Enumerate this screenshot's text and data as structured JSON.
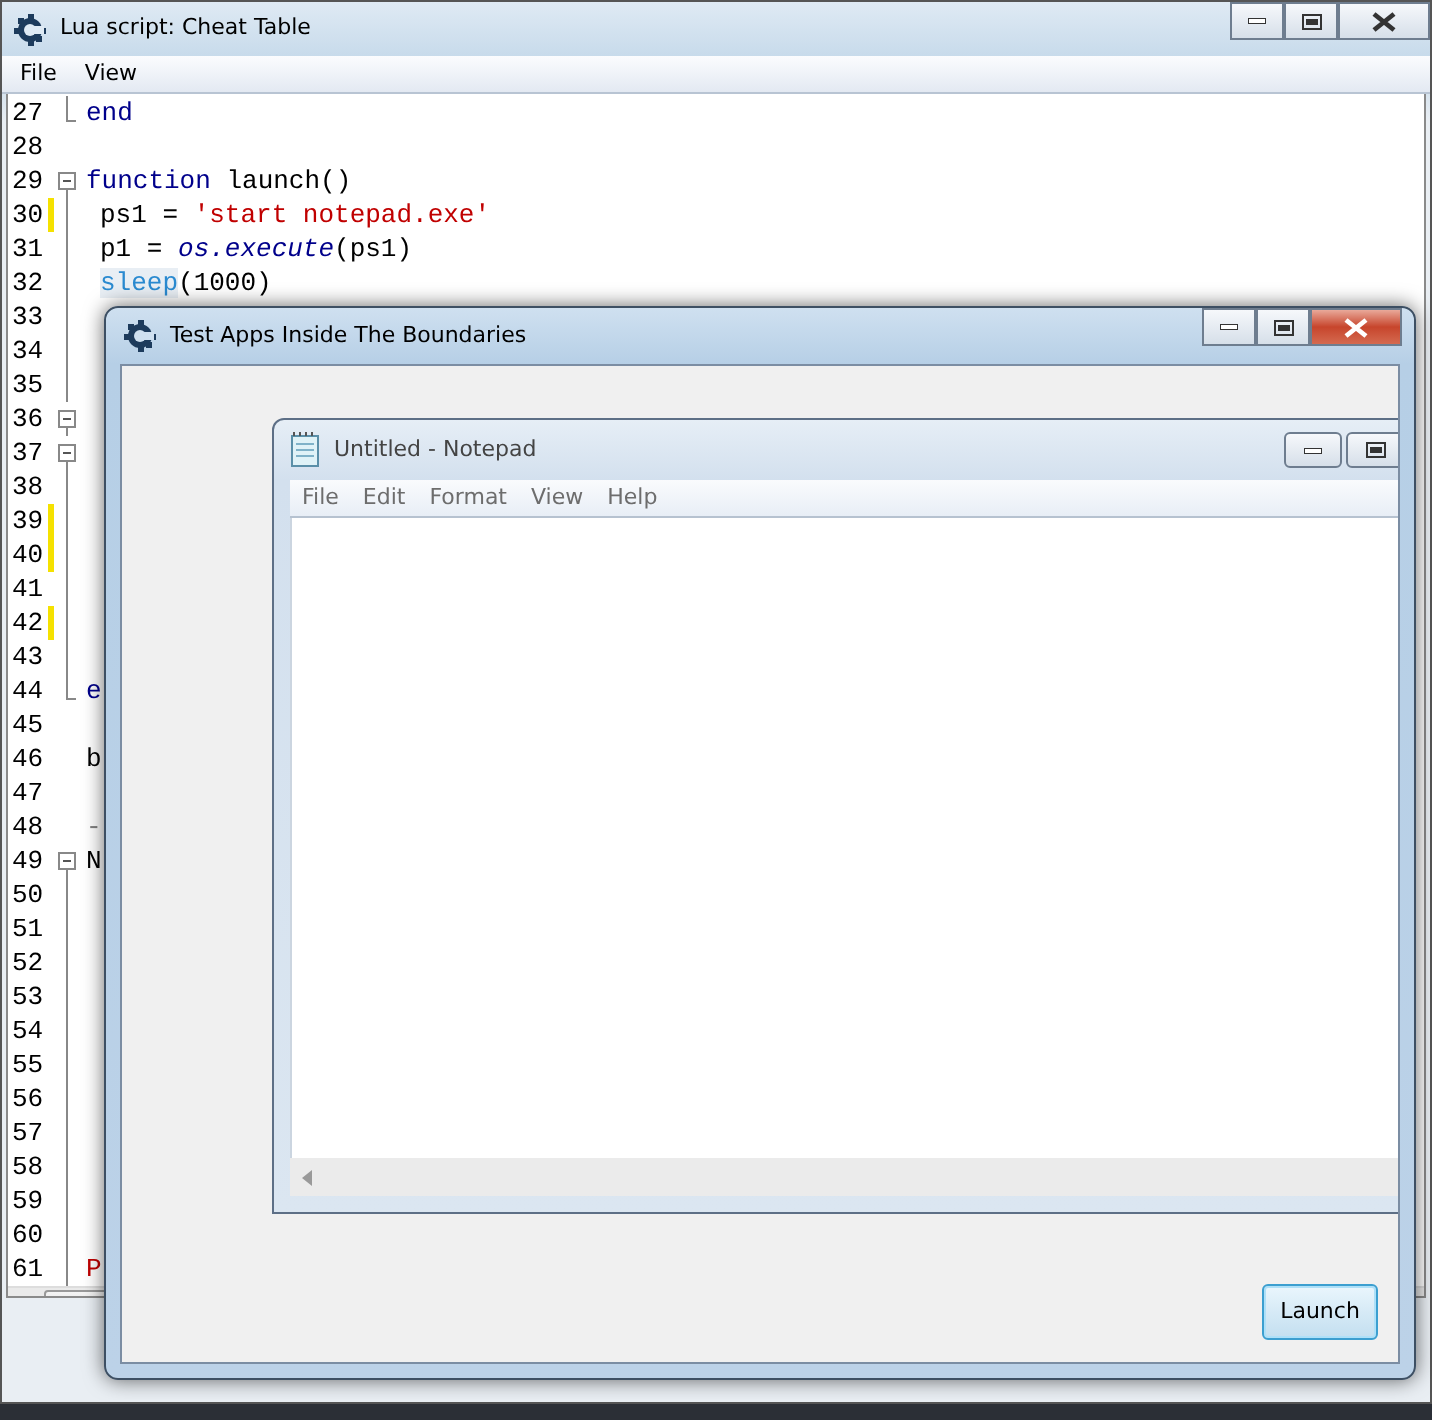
{
  "editor_window": {
    "title": "Lua script: Cheat Table",
    "menu": [
      {
        "label": "File"
      },
      {
        "label": "View"
      }
    ],
    "lines": [
      {
        "number": "27",
        "changed": false,
        "kind": "end",
        "indented": false,
        "tokens": [
          {
            "kind": "keyword",
            "text": "end"
          }
        ]
      },
      {
        "number": "28",
        "changed": false,
        "kind": "plain"
      },
      {
        "number": "29",
        "changed": false,
        "kind": "start",
        "indented": false,
        "tokens": [
          {
            "kind": "keyword",
            "text": "function"
          },
          {
            "kind": "plain",
            "text": " launch()"
          }
        ]
      },
      {
        "number": "30",
        "changed": true,
        "kind": "body",
        "indented": true,
        "tokens": [
          {
            "kind": "plain",
            "text": "ps1 = "
          },
          {
            "kind": "string",
            "text": "'start notepad.exe'"
          }
        ]
      },
      {
        "number": "31",
        "changed": false,
        "kind": "body",
        "indented": true,
        "tokens": [
          {
            "kind": "plain",
            "text": "p1 = "
          },
          {
            "kind": "library",
            "text": "os.execute"
          },
          {
            "kind": "plain",
            "text": "(ps1)"
          }
        ]
      },
      {
        "number": "32",
        "changed": false,
        "kind": "body",
        "indented": true,
        "tokens": [
          {
            "kind": "builtin",
            "text": "sleep"
          },
          {
            "kind": "plain",
            "text": "(1000)"
          }
        ]
      },
      {
        "number": "33",
        "changed": false,
        "kind": "body"
      },
      {
        "number": "34",
        "changed": false,
        "kind": "body"
      },
      {
        "number": "35",
        "changed": false,
        "kind": "body"
      },
      {
        "number": "36",
        "changed": false,
        "kind": "start"
      },
      {
        "number": "37",
        "changed": false,
        "kind": "start"
      },
      {
        "number": "38",
        "changed": false,
        "kind": "body"
      },
      {
        "number": "39",
        "changed": true,
        "kind": "body"
      },
      {
        "number": "40",
        "changed": true,
        "kind": "body"
      },
      {
        "number": "41",
        "changed": false,
        "kind": "body"
      },
      {
        "number": "42",
        "changed": true,
        "kind": "body"
      },
      {
        "number": "43",
        "changed": false,
        "kind": "body"
      },
      {
        "number": "44",
        "changed": false,
        "kind": "end",
        "indented": false,
        "tokens": [
          {
            "kind": "keyword",
            "text": "e"
          }
        ]
      },
      {
        "number": "45",
        "changed": false,
        "kind": "plain"
      },
      {
        "number": "46",
        "changed": false,
        "kind": "plain",
        "indented": false,
        "tokens": [
          {
            "kind": "plain",
            "text": "b"
          }
        ]
      },
      {
        "number": "47",
        "changed": false,
        "kind": "plain"
      },
      {
        "number": "48",
        "changed": false,
        "kind": "plain",
        "indented": false,
        "tokens": [
          {
            "kind": "comment",
            "text": "-"
          }
        ]
      },
      {
        "number": "49",
        "changed": false,
        "kind": "start",
        "indented": false,
        "tokens": [
          {
            "kind": "plain",
            "text": "N"
          }
        ]
      },
      {
        "number": "50",
        "changed": false,
        "kind": "body"
      },
      {
        "number": "51",
        "changed": false,
        "kind": "body"
      },
      {
        "number": "52",
        "changed": false,
        "kind": "body"
      },
      {
        "number": "53",
        "changed": false,
        "kind": "body"
      },
      {
        "number": "54",
        "changed": false,
        "kind": "body"
      },
      {
        "number": "55",
        "changed": false,
        "kind": "body"
      },
      {
        "number": "56",
        "changed": false,
        "kind": "body"
      },
      {
        "number": "57",
        "changed": false,
        "kind": "body"
      },
      {
        "number": "58",
        "changed": false,
        "kind": "body"
      },
      {
        "number": "59",
        "changed": false,
        "kind": "body"
      },
      {
        "number": "60",
        "changed": false,
        "kind": "body"
      },
      {
        "number": "61",
        "changed": false,
        "kind": "body",
        "indented": false,
        "tokens": [
          {
            "kind": "string",
            "text": "P"
          }
        ]
      }
    ]
  },
  "dialog": {
    "title": "Test Apps Inside The Boundaries",
    "button": "Launch"
  },
  "notepad": {
    "title": "Untitled - Notepad",
    "menu": [
      {
        "label": "File"
      },
      {
        "label": "Edit"
      },
      {
        "label": "Format"
      },
      {
        "label": "View"
      },
      {
        "label": "Help"
      }
    ]
  }
}
